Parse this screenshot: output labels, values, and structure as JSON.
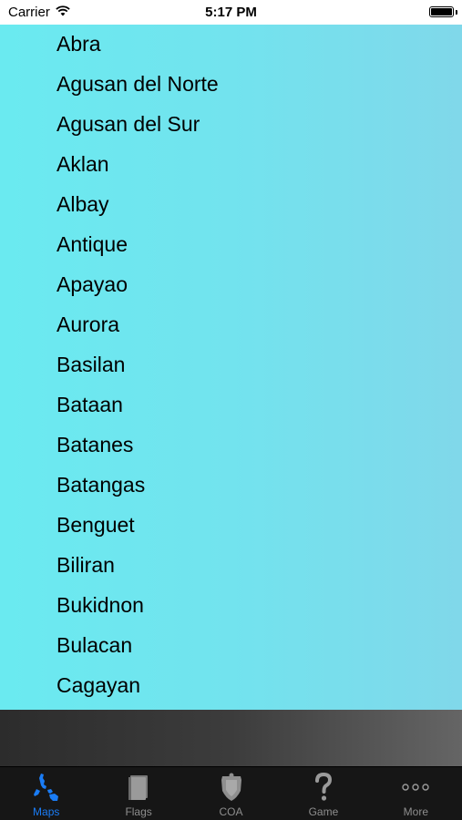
{
  "status_bar": {
    "carrier": "Carrier",
    "time": "5:17 PM"
  },
  "provinces": [
    "Abra",
    "Agusan del Norte",
    "Agusan del Sur",
    "Aklan",
    "Albay",
    "Antique",
    "Apayao",
    "Aurora",
    "Basilan",
    "Bataan",
    "Batanes",
    "Batangas",
    "Benguet",
    "Biliran",
    "Bukidnon",
    "Bulacan",
    "Cagayan"
  ],
  "tabs": [
    {
      "label": "Maps",
      "icon": "philippines-map-icon",
      "active": true
    },
    {
      "label": "Flags",
      "icon": "flag-book-icon",
      "active": false
    },
    {
      "label": "COA",
      "icon": "coat-of-arms-icon",
      "active": false
    },
    {
      "label": "Game",
      "icon": "question-mark-icon",
      "active": false
    },
    {
      "label": "More",
      "icon": "more-dots-icon",
      "active": false
    }
  ],
  "colors": {
    "accent": "#1a7cf5",
    "list_bg_start": "#6aeaf0",
    "list_bg_end": "#80d8ea",
    "tab_bar_bg": "#161616"
  }
}
